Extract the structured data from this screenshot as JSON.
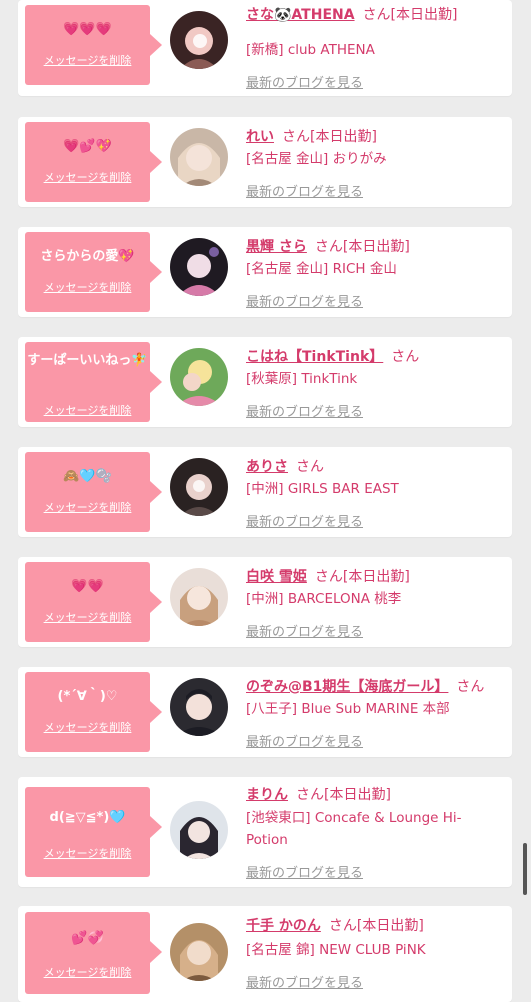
{
  "common": {
    "delete_label": "メッセージを削除",
    "blog_label": "最新のブログを見る",
    "accent_color": "#d43b6b",
    "bubble_color": "#fa97a7"
  },
  "entries": [
    {
      "message": "💗💗💗",
      "name": "さな🐼ATHENA",
      "honor": "さん[本日出勤]",
      "shop": "[新橋] club ATHENA",
      "avatar_colors": [
        "#3a2424",
        "#f1c9c4",
        "#8a5a54"
      ]
    },
    {
      "message": "💗💕💖",
      "name": "れい",
      "honor": "さん[本日出勤]",
      "shop": "[名古屋 金山] おりがみ",
      "avatar_colors": [
        "#c9b7a7",
        "#f4e3d9",
        "#a38a78"
      ]
    },
    {
      "message": "さらからの愛💖",
      "name": "黒輝 さら",
      "honor": "さん[本日出勤]",
      "shop": "[名古屋 金山] RICH 金山",
      "avatar_colors": [
        "#1f1a22",
        "#f0dde6",
        "#d67aa8"
      ]
    },
    {
      "message": "すーぱーいいねっ🧚",
      "name": "こはね【TinkTink】",
      "honor": "さん",
      "shop": "[秋葉原] TinkTink",
      "avatar_colors": [
        "#6ea95a",
        "#f6e39a",
        "#e58aa9"
      ]
    },
    {
      "message": "🙈🩵🫧",
      "name": "ありさ",
      "honor": "さん",
      "shop": "[中洲] GIRLS BAR EAST",
      "avatar_colors": [
        "#2a2222",
        "#e9d1cc",
        "#5a4a48"
      ]
    },
    {
      "message": "💗💗",
      "name": "白咲 雪姫",
      "honor": "さん[本日出勤]",
      "shop": "[中洲] BARCELONA 桃李",
      "avatar_colors": [
        "#e9ded8",
        "#f6e6dc",
        "#b88a68"
      ]
    },
    {
      "message": "(*´∀｀)♡",
      "name": "のぞみ@B1期生【海底ガール】",
      "honor": "さん",
      "shop": "[八王子] Blue Sub MARINE 本部",
      "avatar_colors": [
        "#2b2a30",
        "#f3e1da",
        "#1c1c24"
      ]
    },
    {
      "message": "d(≧▽≦*)🩵",
      "name": "まりん",
      "honor": "さん[本日出勤]",
      "shop": "[池袋東口] Concafe & Lounge Hi-Potion",
      "avatar_colors": [
        "#dfe4ea",
        "#2a2630",
        "#f2e4e0"
      ]
    },
    {
      "message": "💕💞",
      "name": "千手 かのん",
      "honor": "さん[本日出勤]",
      "shop": "[名古屋 錦] NEW CLUB PiNK",
      "avatar_colors": [
        "#b49068",
        "#f1dccb",
        "#7b5a3e"
      ]
    }
  ]
}
